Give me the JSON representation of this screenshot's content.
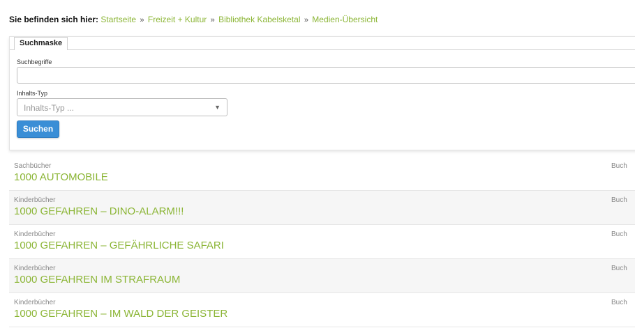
{
  "breadcrumb": {
    "label": "Sie befinden sich hier:",
    "separator": "»",
    "items": [
      "Startseite",
      "Freizeit + Kultur",
      "Bibliothek Kabelsketal",
      "Medien-Übersicht"
    ]
  },
  "search_form": {
    "tab_label": "Suchmaske",
    "keywords_label": "Suchbegriffe",
    "keywords_value": "",
    "type_label": "Inhalts-Typ",
    "type_placeholder": "Inhalts-Typ ...",
    "submit_label": "Suchen"
  },
  "results": [
    {
      "category": "Sachbücher",
      "title": "1000 AUTOMOBILE",
      "type": "Buch"
    },
    {
      "category": "Kinderbücher",
      "title": "1000 GEFAHREN – DINO-ALARM!!!",
      "type": "Buch"
    },
    {
      "category": "Kinderbücher",
      "title": "1000 GEFAHREN – GEFÄHRLICHE SAFARI",
      "type": "Buch"
    },
    {
      "category": "Kinderbücher",
      "title": "1000 GEFAHREN IM STRAFRAUM",
      "type": "Buch"
    },
    {
      "category": "Kinderbücher",
      "title": "1000 GEFAHREN – IM WALD DER GEISTER",
      "type": "Buch"
    }
  ],
  "colors": {
    "link": "#8bb535",
    "button": "#3a8ed6",
    "row_alt": "#f6f6f6"
  }
}
